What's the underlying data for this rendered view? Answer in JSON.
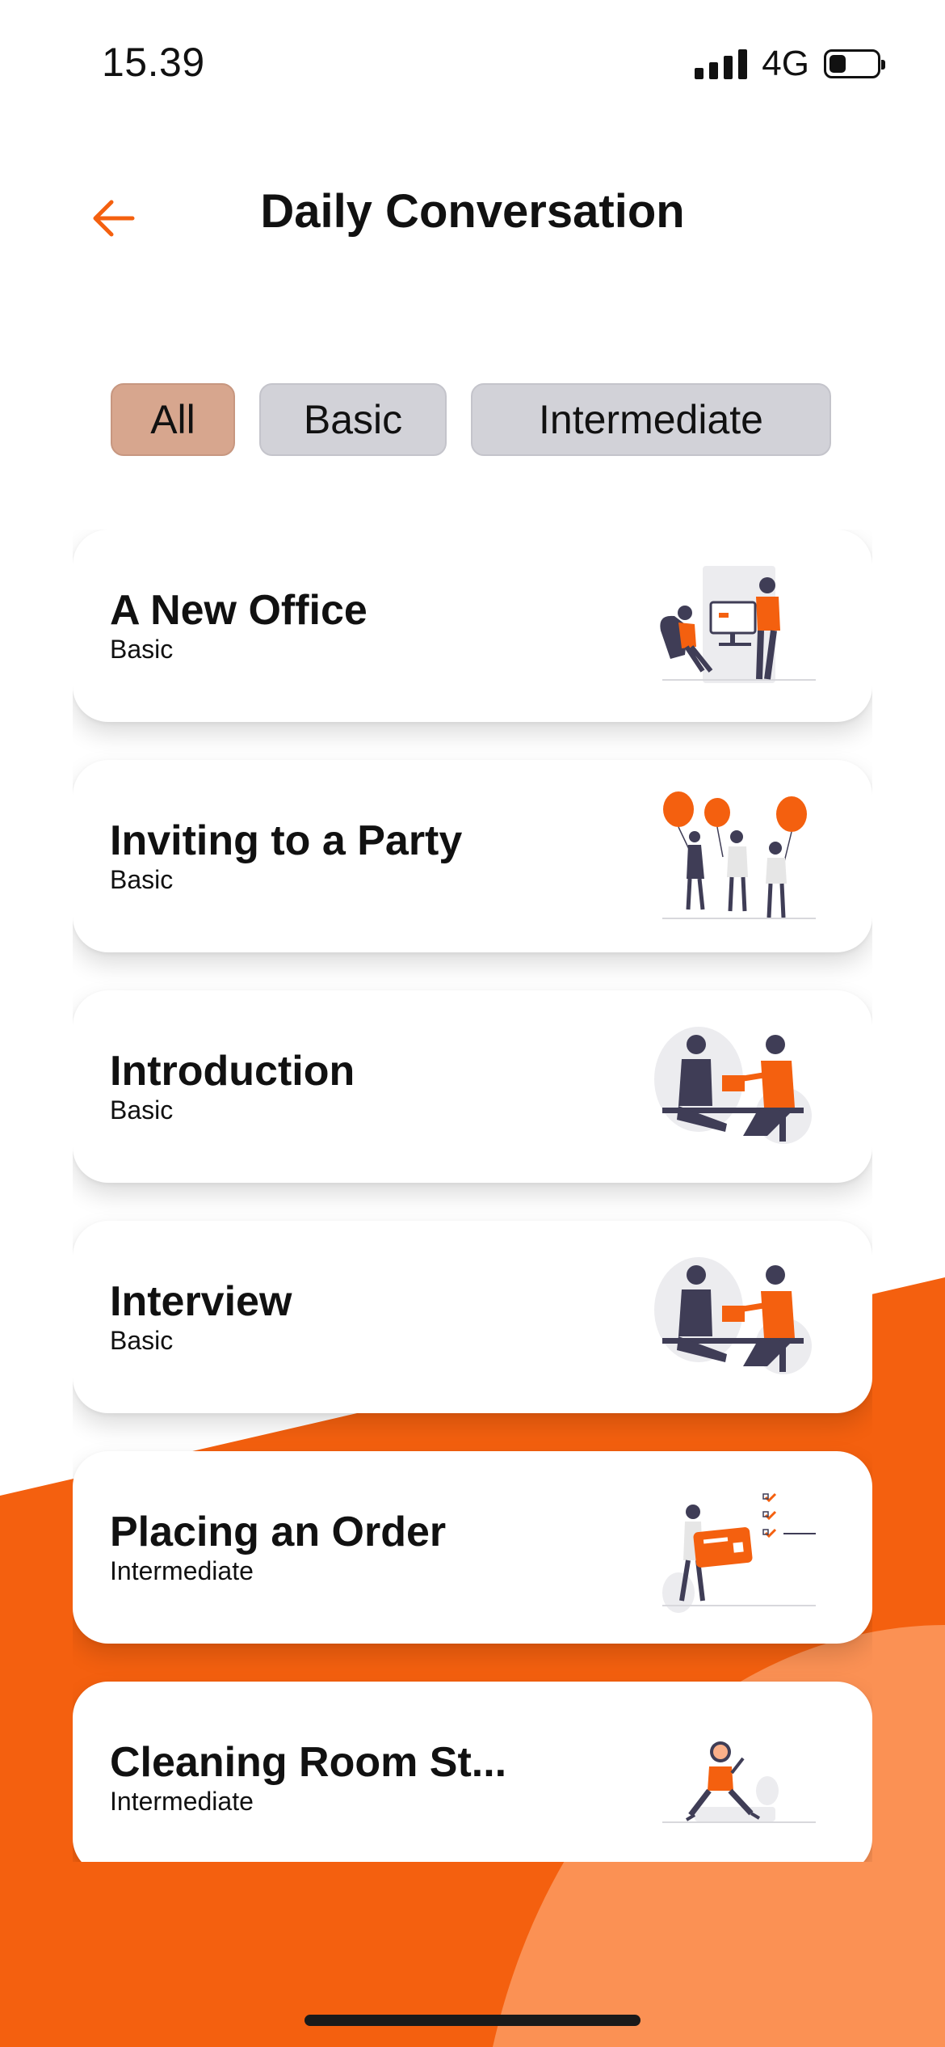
{
  "status_bar": {
    "time": "15.39",
    "network": "4G"
  },
  "header": {
    "title": "Daily Conversation",
    "back_icon": "arrow-left-icon"
  },
  "filters": {
    "selected": "All",
    "tabs": [
      {
        "label": "All"
      },
      {
        "label": "Basic"
      },
      {
        "label": "Intermediate"
      }
    ]
  },
  "lessons": [
    {
      "title": "A New Office",
      "level": "Basic",
      "illustration": "office-illustration-icon"
    },
    {
      "title": "Inviting to a Party",
      "level": "Basic",
      "illustration": "party-balloons-illustration-icon"
    },
    {
      "title": "Introduction",
      "level": "Basic",
      "illustration": "handshake-illustration-icon"
    },
    {
      "title": "Interview",
      "level": "Basic",
      "illustration": "handshake-illustration-icon"
    },
    {
      "title": "Placing an Order",
      "level": "Intermediate",
      "illustration": "order-card-illustration-icon"
    },
    {
      "title": "Cleaning Room St...",
      "level": "Intermediate",
      "illustration": "cleaning-illustration-icon"
    }
  ],
  "colors": {
    "accent": "#F4600F",
    "accent_light": "#FB9154",
    "tab_active": "#D7A68E",
    "tab_inactive": "#D2D2D8"
  }
}
